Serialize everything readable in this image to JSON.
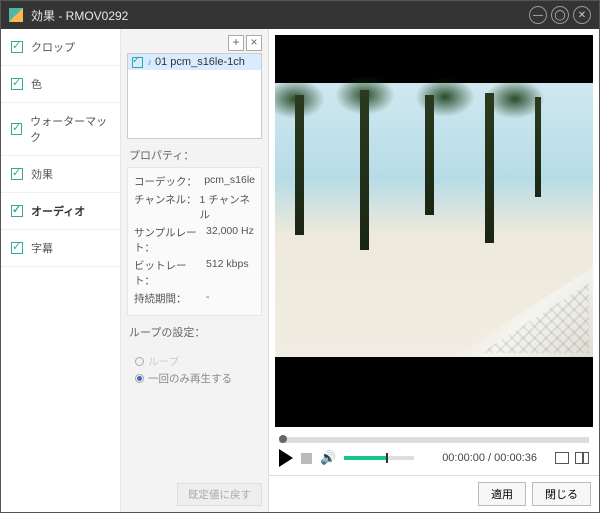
{
  "title": "効果 - RMOV0292",
  "sidebar": {
    "items": [
      {
        "label": "クロップ"
      },
      {
        "label": "色"
      },
      {
        "label": "ウォーターマック"
      },
      {
        "label": "効果"
      },
      {
        "label": "オーディオ"
      },
      {
        "label": "字幕"
      }
    ]
  },
  "tracklist": {
    "items": [
      {
        "label": "01 pcm_s16le-1ch"
      }
    ]
  },
  "properties": {
    "title": "プロパティ：",
    "rows": {
      "codec_k": "コーデック：",
      "codec_v": "pcm_s16le",
      "channel_k": "チャンネル：",
      "channel_v": "1 チャンネル",
      "sample_k": "サンプルレート：",
      "sample_v": "32,000 Hz",
      "bitrate_k": "ビットレート：",
      "bitrate_v": "512 kbps",
      "duration_k": "持続期間：",
      "duration_v": "-"
    }
  },
  "loop": {
    "title": "ループの設定：",
    "opt_loop": "ループ",
    "opt_once": "一回のみ再生する"
  },
  "reset_button": "既定値に戻す",
  "playback": {
    "time": "00:00:00 / 00:00:36"
  },
  "footer": {
    "apply": "適用",
    "close": "閉じる"
  }
}
